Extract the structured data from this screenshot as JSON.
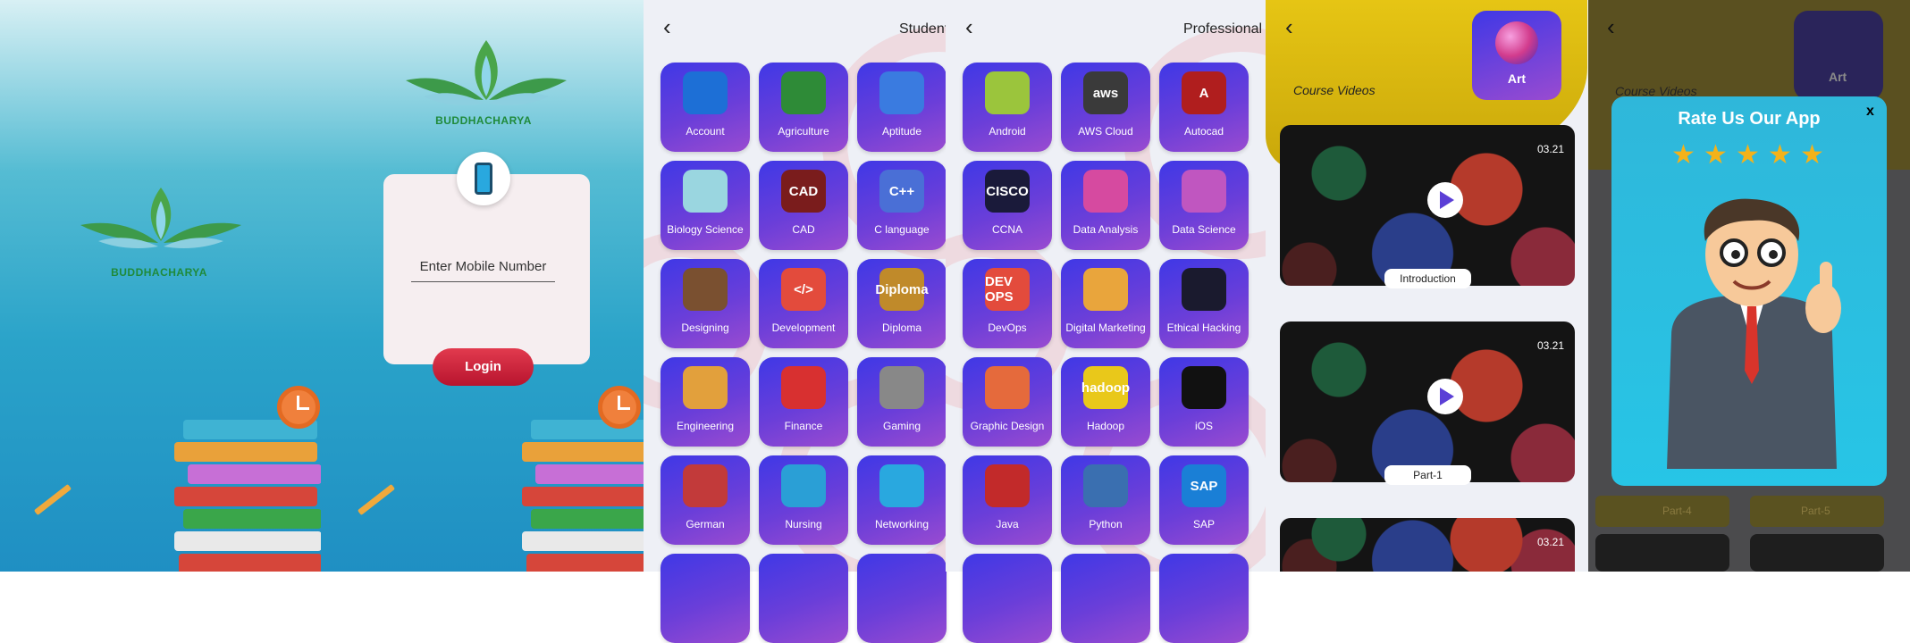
{
  "splash": {
    "brand": "BUDDHACHARYA"
  },
  "login": {
    "brand": "BUDDHACHARYA",
    "mobile_placeholder": "Enter Mobile Number",
    "login_label": "Login"
  },
  "student": {
    "back": "‹",
    "title": "Student",
    "tiles": [
      {
        "label": "Account",
        "icon": "calculator-icon",
        "color": "#1d6fd6"
      },
      {
        "label": "Agriculture",
        "icon": "leaf-icon",
        "color": "#2e8b37"
      },
      {
        "label": "Aptitude",
        "icon": "head-gear-icon",
        "color": "#3a7be0"
      },
      {
        "label": "Biology Science",
        "icon": "dna-icon",
        "color": "#9ad6e0"
      },
      {
        "label": "CAD",
        "icon": "cad-icon",
        "color": "#7a1c1c",
        "text": "CAD"
      },
      {
        "label": "C language",
        "icon": "c-plus-plus-icon",
        "color": "#4a6fd6",
        "text": "C++"
      },
      {
        "label": "Designing",
        "icon": "palette-icon",
        "color": "#7a5030"
      },
      {
        "label": "Development",
        "icon": "code-monitor-icon",
        "color": "#e34b3c",
        "text": "</>"
      },
      {
        "label": "Diploma",
        "icon": "diploma-icon",
        "color": "#c08a2a",
        "text": "Diploma"
      },
      {
        "label": "Engineering",
        "icon": "engineer-icon",
        "color": "#e2a03c"
      },
      {
        "label": "Finance",
        "icon": "growth-chart-icon",
        "color": "#d83030"
      },
      {
        "label": "Gaming",
        "icon": "gamepad-icon",
        "color": "#888888"
      },
      {
        "label": "German",
        "icon": "german-flag-icon",
        "color": "#c23a3a"
      },
      {
        "label": "Nursing",
        "icon": "nurse-icon",
        "color": "#2a9fd6"
      },
      {
        "label": "Networking",
        "icon": "network-icon",
        "color": "#29a8df"
      }
    ]
  },
  "professional": {
    "back": "‹",
    "title": "Professional",
    "tiles": [
      {
        "label": "Android",
        "icon": "android-icon",
        "color": "#9bc53c"
      },
      {
        "label": "AWS Cloud",
        "icon": "aws-icon",
        "color": "#3a3a3a",
        "text": "aws"
      },
      {
        "label": "Autocad",
        "icon": "autocad-icon",
        "color": "#b01e1e",
        "text": "A"
      },
      {
        "label": "CCNA",
        "icon": "cisco-icon",
        "color": "#1a1a3a",
        "text": "CISCO"
      },
      {
        "label": "Data Analysis",
        "icon": "bar-chart-icon",
        "color": "#d64aa0"
      },
      {
        "label": "Data Science",
        "icon": "brain-icon",
        "color": "#c056c0"
      },
      {
        "label": "DevOps",
        "icon": "devops-icon",
        "color": "#e34b3c",
        "text": "DEV OPS"
      },
      {
        "label": "Digital Marketing",
        "icon": "marketing-icon",
        "color": "#e9a53c"
      },
      {
        "label": "Ethical Hacking",
        "icon": "hacker-icon",
        "color": "#1a1a2e"
      },
      {
        "label": "Graphic Design",
        "icon": "pen-tool-icon",
        "color": "#e56a3c"
      },
      {
        "label": "Hadoop",
        "icon": "hadoop-icon",
        "color": "#e9c81a",
        "text": "hadoop"
      },
      {
        "label": "iOS",
        "icon": "apple-icon",
        "color": "#111111"
      },
      {
        "label": "Java",
        "icon": "java-icon",
        "color": "#c22a2a"
      },
      {
        "label": "Python",
        "icon": "python-icon",
        "color": "#3a6fb0"
      },
      {
        "label": "SAP",
        "icon": "sap-icon",
        "color": "#1a7fd6",
        "text": "SAP"
      }
    ]
  },
  "videos": {
    "back": "‹",
    "category": "Art",
    "section_title": "Course Videos",
    "items": [
      {
        "duration": "03.21",
        "label": "Introduction"
      },
      {
        "duration": "03.21",
        "label": "Part-1"
      },
      {
        "duration": "03.21",
        "label": ""
      }
    ]
  },
  "rating": {
    "back": "‹",
    "category": "Art",
    "section_title": "Course Videos",
    "title": "Rate Us Our App",
    "close": "x",
    "stars": 5,
    "dim_labels": [
      "Part-4",
      "Part-5"
    ]
  }
}
